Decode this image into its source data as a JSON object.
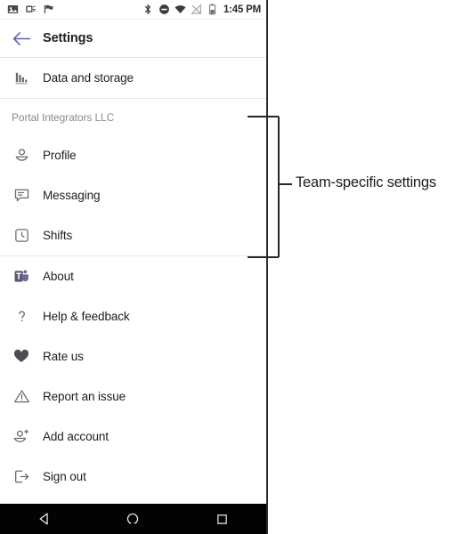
{
  "phone": {
    "statusbar": {
      "left_icons": [
        "screenshot-icon",
        "app-update-icon",
        "flag-icon"
      ],
      "right_icons": [
        "bluetooth-icon",
        "do-not-disturb-icon",
        "wifi-icon",
        "cellular-signal-off-icon",
        "battery-icon"
      ],
      "clock": "1:45 PM"
    },
    "appbar": {
      "back_icon": "back-arrow-icon",
      "title": "Settings",
      "accent_color": "#6264a7"
    },
    "list": {
      "top_items": [
        {
          "icon": "data-usage-icon",
          "label": "Data and storage"
        }
      ],
      "team_section": {
        "header": "Portal Integrators LLC",
        "items": [
          {
            "icon": "profile-person-icon",
            "label": "Profile"
          },
          {
            "icon": "messaging-chat-icon",
            "label": "Messaging"
          },
          {
            "icon": "shifts-clock-icon",
            "label": "Shifts"
          }
        ]
      },
      "bottom_items": [
        {
          "icon": "microsoft-teams-logo-icon",
          "label": "About"
        },
        {
          "icon": "question-mark-icon",
          "label": "Help & feedback"
        },
        {
          "icon": "heart-icon",
          "label": "Rate us"
        },
        {
          "icon": "warning-triangle-icon",
          "label": "Report an issue"
        },
        {
          "icon": "add-person-icon",
          "label": "Add account"
        },
        {
          "icon": "sign-out-icon",
          "label": "Sign out"
        }
      ]
    },
    "navbar": {
      "buttons": [
        {
          "icon": "android-back-icon",
          "label": "Back"
        },
        {
          "icon": "android-home-icon",
          "label": "Home"
        },
        {
          "icon": "android-recents-icon",
          "label": "Recents"
        }
      ]
    }
  },
  "annotation": {
    "label": "Team-specific settings",
    "color": "#262626"
  }
}
